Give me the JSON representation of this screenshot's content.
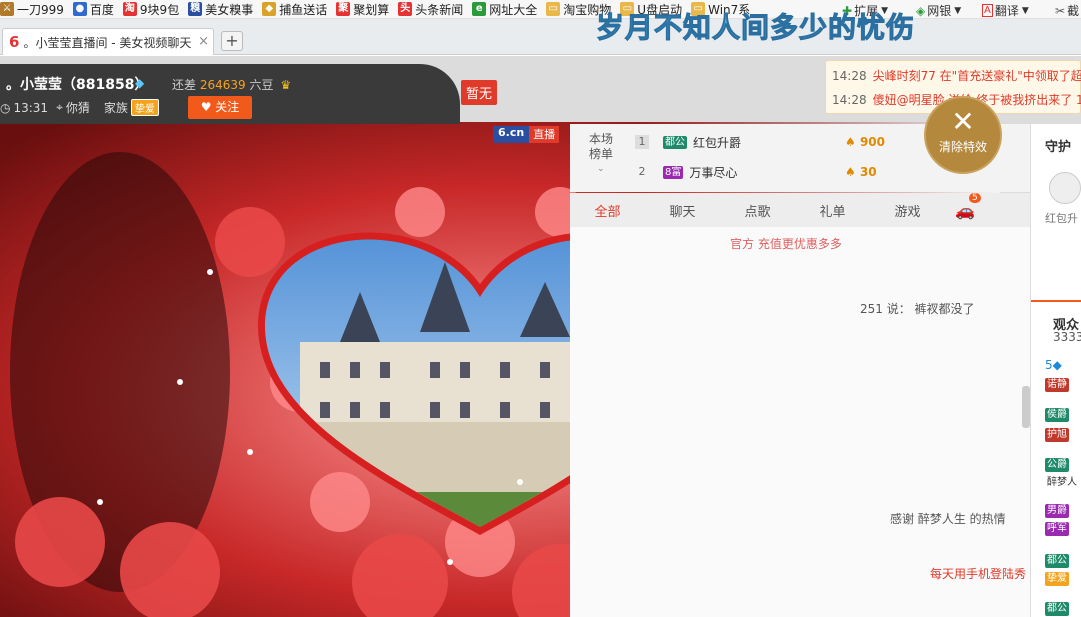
{
  "bookmarks": [
    {
      "label": "一刀999",
      "icon": "sword-icon",
      "color": "#b07a2a"
    },
    {
      "label": "百度",
      "icon": "baidu-paw-icon",
      "color": "#2e6ad1"
    },
    {
      "label": "9块9包",
      "icon": "tao-icon",
      "color": "#e53333"
    },
    {
      "label": "美女糗事",
      "icon": "qiu-icon",
      "color": "#2a4fa0"
    },
    {
      "label": "捕鱼送话",
      "icon": "fish-icon",
      "color": "#d9a32a"
    },
    {
      "label": "聚划算",
      "icon": "ju-icon",
      "color": "#e53333"
    },
    {
      "label": "头条新闻",
      "icon": "news-icon",
      "color": "#e53333"
    },
    {
      "label": "网址大全",
      "icon": "web-icon",
      "color": "#2a9a3a"
    },
    {
      "label": "淘宝购物",
      "icon": "folder-icon",
      "color": "#e8b84a"
    },
    {
      "label": "U盘启动",
      "icon": "folder-icon",
      "color": "#e8b84a"
    },
    {
      "label": "Win7系",
      "icon": "folder-icon",
      "color": "#e8b84a"
    }
  ],
  "toolbar_right": {
    "extend": "扩展",
    "bank": "网银",
    "translate": "翻译",
    "more": "截"
  },
  "tab": {
    "title": "。小莹莹直播间 - 美女视频聊天",
    "close": "×",
    "new": "+"
  },
  "overlay_title": "岁月不知人间多少的忧伤",
  "header": {
    "name": "。小莹莹（881858）",
    "diff_label": "还差",
    "diff_value": "264639",
    "diff_unit": "六豆",
    "time": "13:31",
    "location": "你猜",
    "family_label": "家族",
    "family_badge": "挚爱",
    "follow_label": "关注"
  },
  "tag_pause": "暂无",
  "logo": {
    "site": "6.cn",
    "live": "直播"
  },
  "notices": [
    {
      "time": "14:28",
      "text": "尖峰时刻77 在\"首充送豪礼\"中领取了超"
    },
    {
      "time": "14:28",
      "text": "傻妞@明星脸 送给 终于被我挤出来了 1"
    }
  ],
  "clear_effects": "清除特效",
  "ranking": {
    "title": "本场榜单",
    "rows": [
      {
        "rank": "1",
        "badge": "都公",
        "badge_color": "#1f8a6a",
        "name": "红包升爵",
        "value": "900"
      },
      {
        "rank": "2",
        "badge": "8富",
        "badge_color": "#9a2ab0",
        "name": "万事尽心",
        "value": "30"
      }
    ]
  },
  "chat_tabs": [
    "全部",
    "聊天",
    "点歌",
    "礼单",
    "游戏"
  ],
  "car_count": "5",
  "chat_lines": [
    {
      "text": "官方 充值更优惠多多"
    },
    {
      "text": "251 说：   裤衩都没了"
    },
    {
      "text": "感谢 醉梦人生 的热情"
    },
    {
      "text": "每天用手机登陆秀"
    }
  ],
  "side": {
    "guard": "守护",
    "guard_name": "红包升",
    "audience": "观众",
    "audience_count": "3333",
    "medals": [
      {
        "label": "诺静",
        "color": "#c0392b"
      },
      {
        "label": "侯爵",
        "color": "#1f8a6a"
      },
      {
        "label": "护旭",
        "color": "#c0392b"
      },
      {
        "label": "公爵",
        "color": "#1f8a6a"
      },
      {
        "label": "醉梦人",
        "color": "#fff"
      },
      {
        "label": "男爵",
        "color": "#9a2ab0"
      },
      {
        "label": "呼军",
        "color": "#9a2ab0"
      },
      {
        "label": "都公",
        "color": "#1f8a6a"
      },
      {
        "label": "挚爱",
        "color": "#f4a31d"
      },
      {
        "label": "都公",
        "color": "#1f8a6a"
      }
    ]
  },
  "colors": {
    "accent": "#e03a2a",
    "follow": "#f25a1b",
    "gold": "#b5893d"
  }
}
